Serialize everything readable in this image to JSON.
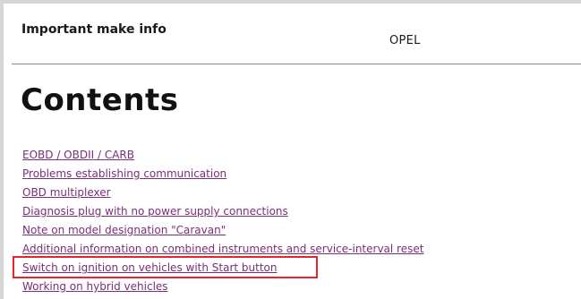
{
  "header": {
    "label": "Important make info",
    "make": "OPEL"
  },
  "contents": {
    "title": "Contents",
    "items": [
      {
        "label": "EOBD / OBDII / CARB"
      },
      {
        "label": "Problems establishing communication"
      },
      {
        "label": "OBD multiplexer"
      },
      {
        "label": "Diagnosis plug with no power supply connections"
      },
      {
        "label": "Note on model designation \"Caravan\""
      },
      {
        "label": "Additional information on combined instruments and service-interval reset"
      },
      {
        "label": "Switch on ignition on vehicles with Start button",
        "highlighted": true
      },
      {
        "label": "Working on hybrid vehicles"
      }
    ]
  },
  "colors": {
    "link": "#7a2e7a",
    "highlight": "#e8232b",
    "divider": "#8a8a8a"
  }
}
